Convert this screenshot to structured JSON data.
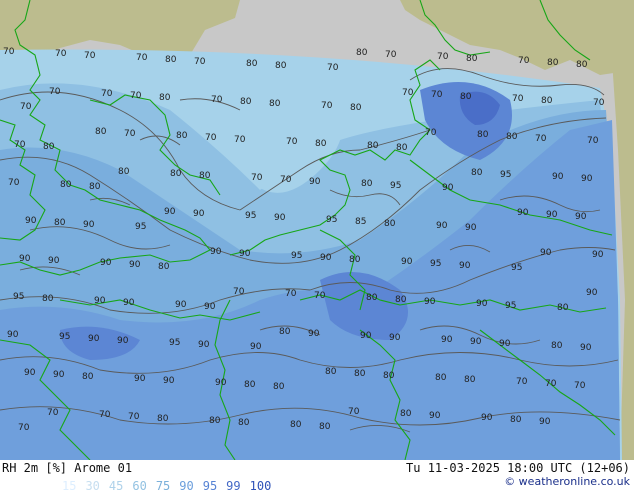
{
  "header": {
    "title": "RH 2m [%] Arome 01",
    "datetime": "Tu 11-03-2025 18:00 UTC (12+06)"
  },
  "legend": {
    "items": [
      {
        "value": "15",
        "color": "#ddeeff"
      },
      {
        "value": "30",
        "color": "#c6def0"
      },
      {
        "value": "45",
        "color": "#afd2ea"
      },
      {
        "value": "60",
        "color": "#93c2e2"
      },
      {
        "value": "75",
        "color": "#7bb0da"
      },
      {
        "value": "90",
        "color": "#6b9edc"
      },
      {
        "value": "95",
        "color": "#5783d4"
      },
      {
        "value": "99",
        "color": "#4368c6"
      },
      {
        "value": "100",
        "color": "#2f52b8"
      }
    ]
  },
  "credit": {
    "icon": "copyright-icon",
    "text": "© weatheronline.co.uk"
  },
  "map": {
    "colors": {
      "land_outside_domain": "#bcbc8e",
      "sea_outside_domain": "#c8c8c8",
      "coastline": "#17a617",
      "isoline": "#5a5a5a"
    },
    "contour_labels": [
      "70",
      "70",
      "70",
      "70",
      "80",
      "70",
      "80",
      "80",
      "70",
      "80",
      "70",
      "70",
      "80",
      "70",
      "80",
      "80",
      "70",
      "70",
      "70",
      "70",
      "80",
      "70",
      "80",
      "80",
      "70",
      "80",
      "70",
      "70",
      "80",
      "70",
      "80",
      "70",
      "70",
      "80",
      "80",
      "70",
      "80",
      "70",
      "70",
      "70",
      "80",
      "80",
      "80",
      "70",
      "80",
      "80",
      "70",
      "70",
      "70",
      "80",
      "80",
      "80",
      "80",
      "80",
      "70",
      "70",
      "90",
      "80",
      "95",
      "90",
      "80",
      "95",
      "90",
      "90",
      "90",
      "80",
      "90",
      "95",
      "90",
      "90",
      "95",
      "90",
      "95",
      "85",
      "80",
      "90",
      "90",
      "90",
      "90",
      "90",
      "90",
      "90",
      "90",
      "90",
      "80",
      "90",
      "90",
      "95",
      "90",
      "80",
      "90",
      "95",
      "90",
      "95",
      "90",
      "90",
      "95",
      "80",
      "90",
      "90",
      "90",
      "90",
      "70",
      "70",
      "70",
      "80",
      "80",
      "90",
      "90",
      "95",
      "80",
      "90",
      "90",
      "95",
      "90",
      "90",
      "95",
      "90",
      "90",
      "80",
      "90",
      "90",
      "90",
      "90",
      "90",
      "90",
      "80",
      "90",
      "90",
      "90",
      "80",
      "90",
      "90",
      "90",
      "80",
      "80",
      "80",
      "80",
      "80",
      "80",
      "80",
      "70",
      "70",
      "70",
      "70",
      "70",
      "70",
      "70",
      "80",
      "80",
      "80",
      "80",
      "80",
      "70",
      "80",
      "90",
      "90",
      "80",
      "90"
    ]
  }
}
